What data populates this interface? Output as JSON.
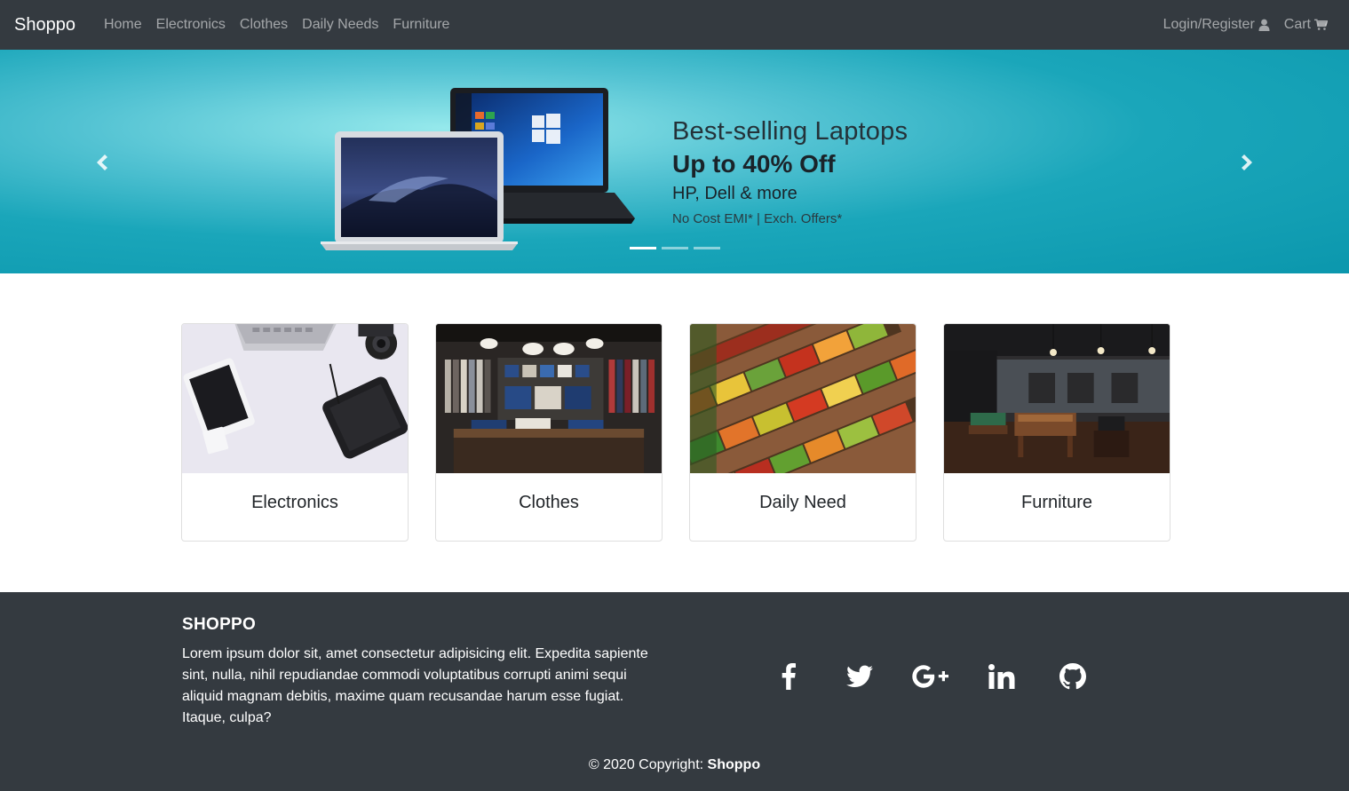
{
  "navbar": {
    "brand": "Shoppo",
    "links": [
      "Home",
      "Electronics",
      "Clothes",
      "Daily Needs",
      "Furniture"
    ],
    "login_label": "Login/Register",
    "cart_label": "Cart",
    "login_icon": "user-icon",
    "cart_icon": "shopping-cart-icon"
  },
  "carousel": {
    "slide": {
      "line1": "Best-selling Laptops",
      "line2": "Up to 40% Off",
      "line3": "HP, Dell & more",
      "line4": "No Cost EMI* | Exch. Offers*"
    },
    "indicator_count": 3,
    "active_index": 0,
    "prev_icon": "chevron-left-icon",
    "next_icon": "chevron-right-icon"
  },
  "categories": [
    {
      "title": "Electronics"
    },
    {
      "title": "Clothes"
    },
    {
      "title": "Daily Need"
    },
    {
      "title": "Furniture"
    }
  ],
  "footer": {
    "title": "SHOPPO",
    "description": "Lorem ipsum dolor sit, amet consectetur adipisicing elit. Expedita sapiente sint, nulla, nihil repudiandae commodi voluptatibus corrupti animi sequi aliquid magnam debitis, maxime quam recusandae harum esse fugiat. Itaque, culpa?",
    "social": [
      "facebook-icon",
      "twitter-icon",
      "google-plus-icon",
      "linkedin-icon",
      "github-icon"
    ],
    "copyright_prefix": "© 2020 Copyright:",
    "copyright_brand": "Shoppo"
  },
  "colors": {
    "navbar_bg": "#343a40",
    "banner_teal": "#0b97ad",
    "footer_bg": "#343a40"
  }
}
